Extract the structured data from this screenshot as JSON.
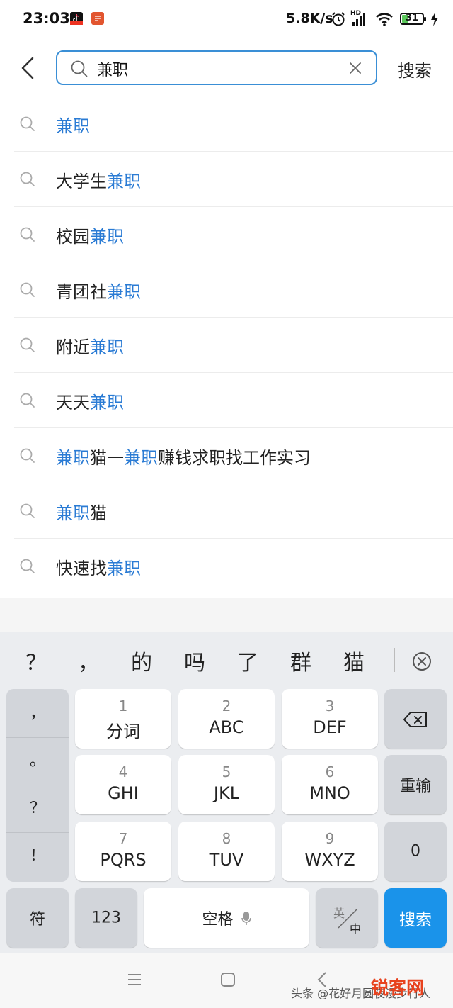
{
  "status_bar": {
    "time": "23:03",
    "network_speed": "5.8K/s",
    "hd_label": "HD",
    "battery": "31",
    "battery_level": 0.31,
    "icons": [
      "tiktok-app-icon",
      "red-app-icon",
      "alarm-icon",
      "signal-icon",
      "wifi-icon",
      "battery-icon",
      "charging-icon"
    ]
  },
  "search": {
    "query": "兼职",
    "button_label": "搜索",
    "accent_color": "#3a8fd6"
  },
  "suggestions": [
    [
      {
        "t": "兼职",
        "h": true
      }
    ],
    [
      {
        "t": "大学生",
        "h": false
      },
      {
        "t": "兼职",
        "h": true
      }
    ],
    [
      {
        "t": "校园",
        "h": false
      },
      {
        "t": "兼职",
        "h": true
      }
    ],
    [
      {
        "t": "青团社",
        "h": false
      },
      {
        "t": "兼职",
        "h": true
      }
    ],
    [
      {
        "t": "附近",
        "h": false
      },
      {
        "t": "兼职",
        "h": true
      }
    ],
    [
      {
        "t": "天天",
        "h": false
      },
      {
        "t": "兼职",
        "h": true
      }
    ],
    [
      {
        "t": "兼职",
        "h": true
      },
      {
        "t": "猫一",
        "h": false
      },
      {
        "t": "兼职",
        "h": true
      },
      {
        "t": "赚钱求职找工作实习",
        "h": false
      }
    ],
    [
      {
        "t": "兼职",
        "h": true
      },
      {
        "t": "猫",
        "h": false
      }
    ],
    [
      {
        "t": "快速找",
        "h": false
      },
      {
        "t": "兼职",
        "h": true
      }
    ]
  ],
  "highlight_color": "#2a7bd4",
  "keyboard": {
    "candidates": [
      "？",
      "，",
      "的",
      "吗",
      "了",
      "群",
      "猫"
    ],
    "punctuation": [
      "，",
      "。",
      "？",
      "！"
    ],
    "keys": [
      {
        "num": "1",
        "label": "分词"
      },
      {
        "num": "2",
        "label": "ABC"
      },
      {
        "num": "3",
        "label": "DEF"
      },
      {
        "num": "4",
        "label": "GHI"
      },
      {
        "num": "5",
        "label": "JKL"
      },
      {
        "num": "6",
        "label": "MNO"
      },
      {
        "num": "7",
        "label": "PQRS"
      },
      {
        "num": "8",
        "label": "TUV"
      },
      {
        "num": "9",
        "label": "WXYZ"
      }
    ],
    "reset_label": "重输",
    "zero_label": "0",
    "symbol_label": "符",
    "num_label": "123",
    "space_label": "空格",
    "lang_en": "英",
    "lang_zh": "中",
    "submit_label": "搜索",
    "submit_color": "#1a93ea"
  },
  "watermark": {
    "text": "头条 @花好月圆夜漫步行人",
    "brand": "锐客网"
  }
}
